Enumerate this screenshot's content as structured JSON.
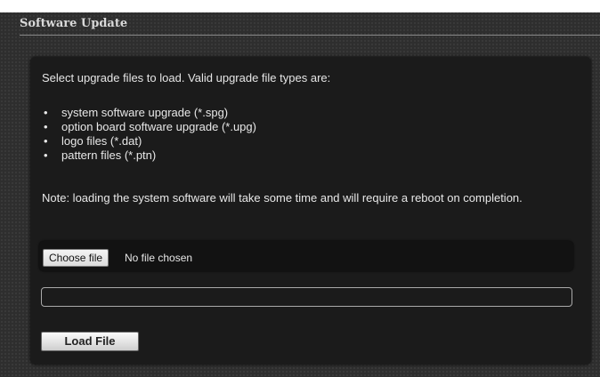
{
  "header": {
    "title": "Software Update"
  },
  "panel": {
    "intro": "Select upgrade files to load. Valid upgrade file types are:",
    "file_types": [
      "system software upgrade (*.spg)",
      "option board software upgrade (*.upg)",
      "logo files (*.dat)",
      "pattern files (*.ptn)"
    ],
    "note": "Note: loading the system software will take some time and will require a reboot on completion.",
    "file_input": {
      "button_label": "Choose file",
      "status": "No file chosen"
    },
    "progress": {
      "value": 0
    },
    "load_button": "Load File"
  }
}
